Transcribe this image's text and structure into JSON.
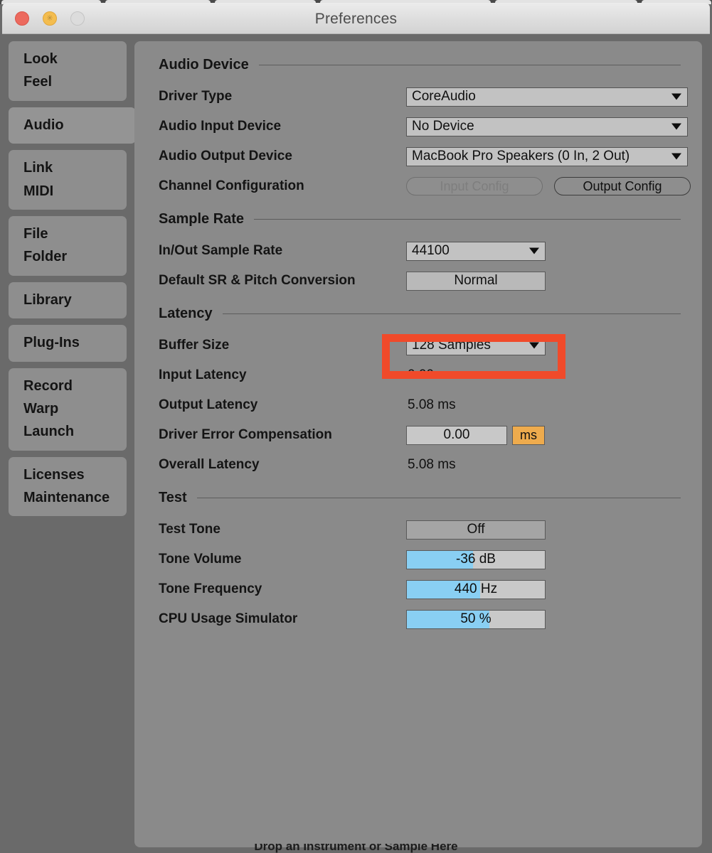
{
  "window": {
    "title": "Preferences",
    "controls": {
      "close_label": "close",
      "minimize_label": "minimize",
      "zoom_label": "zoom"
    }
  },
  "sidebar": {
    "groups": [
      {
        "name": "look-feel",
        "selected": false,
        "items": [
          "Look",
          "Feel"
        ]
      },
      {
        "name": "audio",
        "selected": true,
        "items": [
          "Audio"
        ]
      },
      {
        "name": "link-midi",
        "selected": false,
        "items": [
          "Link",
          "MIDI"
        ]
      },
      {
        "name": "file-folder",
        "selected": false,
        "items": [
          "File",
          "Folder"
        ]
      },
      {
        "name": "library",
        "selected": false,
        "items": [
          "Library"
        ]
      },
      {
        "name": "plug-ins",
        "selected": false,
        "items": [
          "Plug-Ins"
        ]
      },
      {
        "name": "record-warp-launch",
        "selected": false,
        "items": [
          "Record",
          "Warp",
          "Launch"
        ]
      },
      {
        "name": "licenses-maintenance",
        "selected": false,
        "items": [
          "Licenses",
          "Maintenance"
        ]
      }
    ]
  },
  "sections": {
    "audio_device": {
      "heading": "Audio Device",
      "driver_type_label": "Driver Type",
      "driver_type_value": "CoreAudio",
      "audio_input_label": "Audio Input Device",
      "audio_input_value": "No Device",
      "audio_output_label": "Audio Output Device",
      "audio_output_value": "MacBook Pro Speakers (0 In, 2 Out)",
      "channel_config_label": "Channel Configuration",
      "input_config_button": "Input Config",
      "output_config_button": "Output Config"
    },
    "sample_rate": {
      "heading": "Sample Rate",
      "in_out_label": "In/Out Sample Rate",
      "in_out_value": "44100",
      "conversion_label": "Default SR & Pitch Conversion",
      "conversion_value": "Normal"
    },
    "latency": {
      "heading": "Latency",
      "buffer_size_label": "Buffer Size",
      "buffer_size_value": "128 Samples",
      "input_latency_label": "Input Latency",
      "input_latency_value": "0.00 ms",
      "output_latency_label": "Output Latency",
      "output_latency_value": "5.08 ms",
      "driver_error_label": "Driver Error Compensation",
      "driver_error_value": "0.00",
      "driver_error_unit": "ms",
      "overall_latency_label": "Overall Latency",
      "overall_latency_value": "5.08 ms"
    },
    "test": {
      "heading": "Test",
      "test_tone_label": "Test Tone",
      "test_tone_value": "Off",
      "tone_volume_label": "Tone Volume",
      "tone_volume_value": "-36 dB",
      "tone_volume_fill": "48%",
      "tone_frequency_label": "Tone Frequency",
      "tone_frequency_value": "440 Hz",
      "tone_frequency_fill": "53%",
      "cpu_usage_label": "CPU Usage Simulator",
      "cpu_usage_value": "50 %",
      "cpu_usage_fill": "60%"
    }
  },
  "annotation": {
    "highlight_target": "buffer-size-dropdown",
    "highlight_color": "#f04a2a"
  },
  "background_hint": {
    "text": "Drop an Instrument or Sample Here"
  },
  "colors": {
    "window_chrome": "#e3e3e3",
    "panel": "#8a8a8a",
    "outer": "#6a6a6a",
    "sidebar_item": "#8e8e8e",
    "field": "#c2c2c2",
    "slider_fill": "#89cff3",
    "unit_accent": "#eeab4d",
    "highlight": "#f04a2a"
  }
}
